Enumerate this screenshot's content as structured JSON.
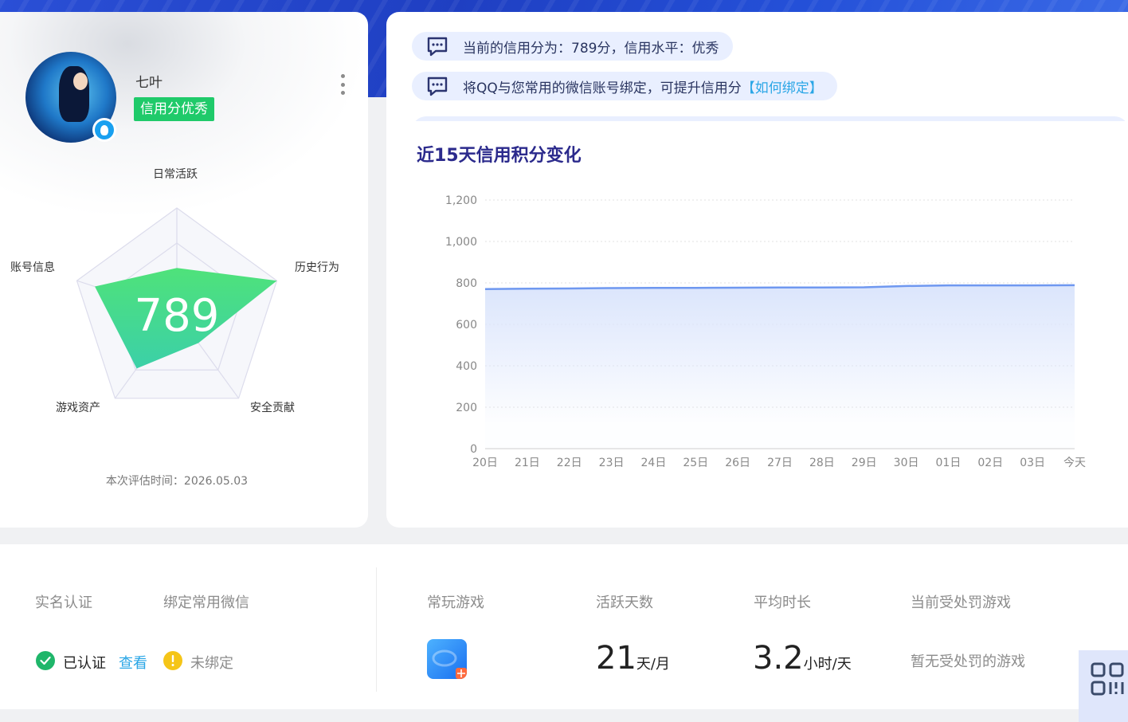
{
  "profile": {
    "username": "七叶",
    "credit_badge": "信用分优秀",
    "score": "789",
    "eval_time": "本次评估时间：2026.05.03",
    "radar_axes": [
      "日常活跃",
      "历史行为",
      "安全贡献",
      "游戏资产",
      "账号信息"
    ],
    "radar_values": [
      0.43,
      1.0,
      0.35,
      0.65,
      0.82
    ]
  },
  "notices": {
    "line1": "当前的信用分为：789分，信用水平：优秀",
    "line2": "将QQ与您常用的微信账号绑定，可提升信用分",
    "line2_link": "【如何绑定】"
  },
  "chart": {
    "title": "近15天信用积分变化"
  },
  "chart_data": {
    "type": "area",
    "title": "近15天信用积分变化",
    "xlabel": "",
    "ylabel": "",
    "x": [
      "20日",
      "21日",
      "22日",
      "23日",
      "24日",
      "25日",
      "26日",
      "27日",
      "28日",
      "29日",
      "30日",
      "01日",
      "02日",
      "03日",
      "今天"
    ],
    "values": [
      770,
      772,
      773,
      775,
      776,
      776,
      777,
      778,
      778,
      779,
      785,
      788,
      788,
      788,
      789
    ],
    "ylim": [
      0,
      1200
    ],
    "yticks": [
      "0",
      "200",
      "400",
      "600",
      "800",
      "1,000",
      "1,200"
    ],
    "grid": true,
    "colors": {
      "line": "#6f98f0",
      "fill": "#dbe5fc"
    }
  },
  "bottom": {
    "realname_label": "实名认证",
    "realname_status": "已认证",
    "realname_view": "查看",
    "wechat_label": "绑定常用微信",
    "wechat_status": "未绑定",
    "games_label": "常玩游戏",
    "active_label": "活跃天数",
    "active_value": "21",
    "active_unit": "天/月",
    "duration_label": "平均时长",
    "duration_value": "3.2",
    "duration_unit": "小时/天",
    "penalty_label": "当前受处罚游戏",
    "penalty_value": "暂无受处罚的游戏"
  },
  "colors": {
    "accent_blue": "#2a4fd6",
    "success_green": "#1fca6a",
    "warning_yellow": "#f5c518",
    "link": "#2aa6e6"
  }
}
